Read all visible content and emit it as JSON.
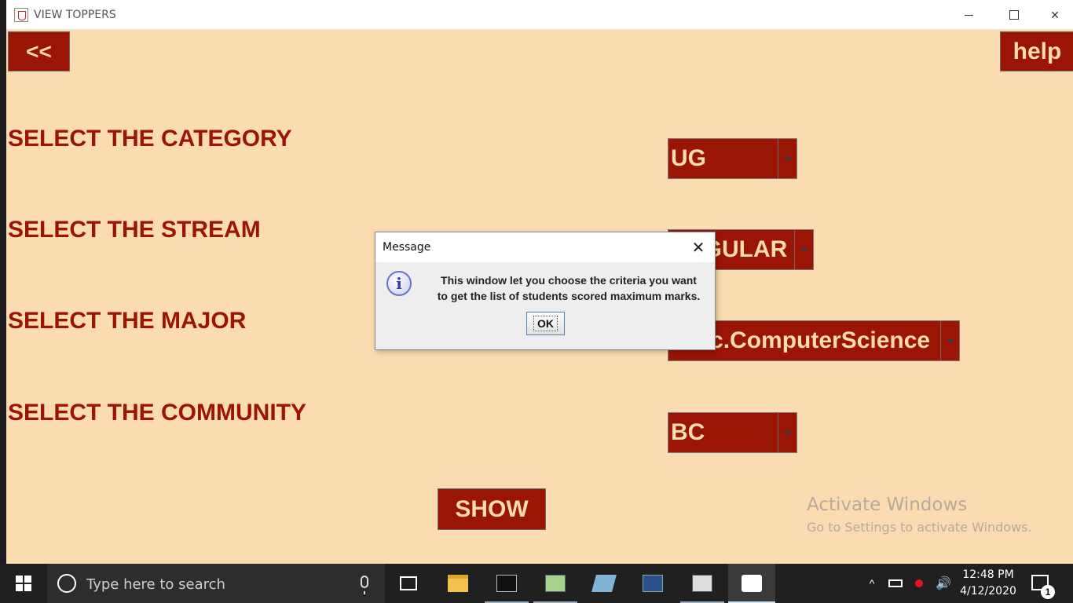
{
  "window": {
    "title": "VIEW TOPPERS",
    "minimize": "—",
    "maximize": "☐",
    "close": "✕"
  },
  "toolbar": {
    "back_label": "<<",
    "help_label": "help",
    "show_label": "SHOW"
  },
  "form": {
    "category_label": "SELECT THE CATEGORY",
    "category_value": "UG",
    "stream_label": "SELECT THE STREAM",
    "stream_value": "REGULAR",
    "major_label": "SELECT THE MAJOR",
    "major_value": "B.Sc.ComputerScience",
    "community_label": "SELECT THE COMMUNITY",
    "community_value": "BC"
  },
  "watermark": {
    "title": "Activate Windows",
    "subtitle": "Go to Settings to activate Windows."
  },
  "dialog": {
    "title": "Message",
    "close": "✕",
    "info_icon": "i",
    "message_line1": "This window let you choose the criteria you want",
    "message_line2": "to get the list of students scored maximum marks.",
    "ok_label": "OK"
  },
  "taskbar": {
    "search_placeholder": "Type here to search",
    "time": "12:48 PM",
    "date": "4/12/2020",
    "notification_count": "1",
    "tray_up": "^",
    "volume": "🔊"
  },
  "colors": {
    "accent": "#9b1505",
    "background": "#fadcb0"
  }
}
